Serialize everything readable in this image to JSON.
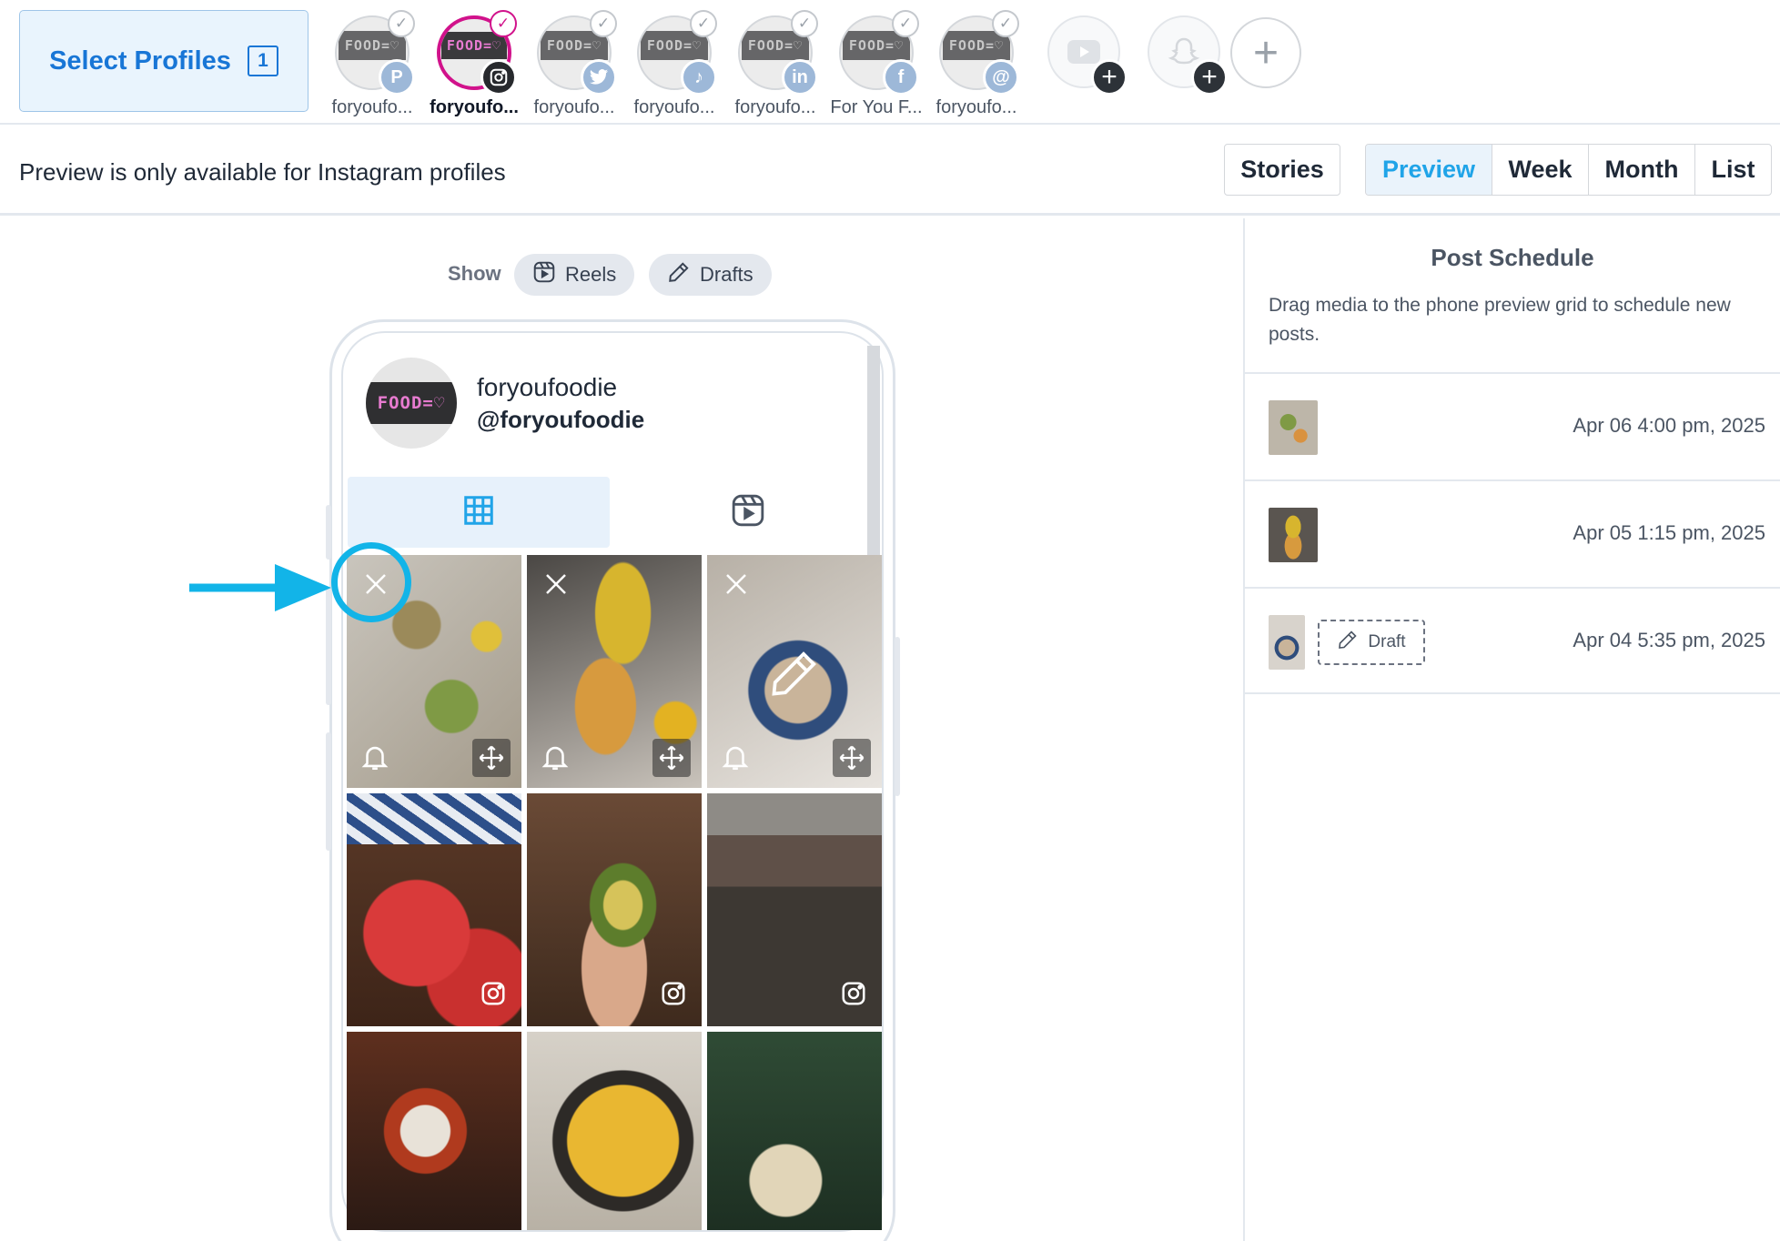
{
  "header": {
    "select_profiles_label": "Select Profiles",
    "selected_count": "1",
    "profiles": [
      {
        "name": "foryoufo...",
        "network_icon": "pinterest-icon",
        "glyph": "P",
        "active": false
      },
      {
        "name": "foryoufo...",
        "network_icon": "instagram-icon",
        "glyph": "",
        "active": true
      },
      {
        "name": "foryoufo...",
        "network_icon": "twitter-icon",
        "glyph": "t",
        "active": false
      },
      {
        "name": "foryoufo...",
        "network_icon": "tiktok-icon",
        "glyph": "♪",
        "active": false
      },
      {
        "name": "foryoufo...",
        "network_icon": "linkedin-icon",
        "glyph": "in",
        "active": false
      },
      {
        "name": "For You F...",
        "network_icon": "facebook-icon",
        "glyph": "f",
        "active": false
      },
      {
        "name": "foryoufo...",
        "network_icon": "threads-icon",
        "glyph": "@",
        "active": false
      }
    ],
    "avatar_sign_text": "FOOD=♡"
  },
  "toolbar": {
    "notice": "Preview is only available for Instagram profiles",
    "stories_label": "Stories",
    "views": [
      "Preview",
      "Week",
      "Month",
      "List"
    ],
    "active_view": "Preview"
  },
  "filters": {
    "show_label": "Show",
    "reels_label": "Reels",
    "drafts_label": "Drafts"
  },
  "phone": {
    "display_name": "foryoufoodie",
    "handle": "@foryoufoodie"
  },
  "schedule": {
    "title": "Post Schedule",
    "description": "Drag media to the phone preview grid to schedule new posts.",
    "items": [
      {
        "date": "Apr 06 4:00 pm, 2025",
        "draft": false
      },
      {
        "date": "Apr 05 1:15 pm, 2025",
        "draft": false
      },
      {
        "date": "Apr 04 5:35 pm, 2025",
        "draft": true,
        "draft_label": "Draft"
      }
    ]
  },
  "colors": {
    "accent": "#20a4e8",
    "brand_blue": "#1876d6",
    "instagram_ring": "#d1128b",
    "highlight": "#12b4e8"
  }
}
